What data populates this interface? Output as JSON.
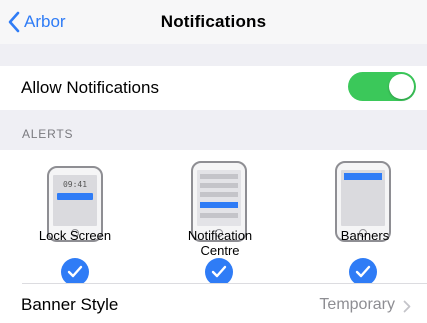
{
  "navbar": {
    "back_label": "Arbor",
    "title": "Notifications"
  },
  "allow": {
    "label": "Allow Notifications",
    "enabled": true
  },
  "alerts": {
    "header": "ALERTS",
    "options": [
      {
        "label": "Lock Screen",
        "checked": true,
        "time_text": "09:41"
      },
      {
        "label": "Notification\nCentre",
        "checked": true
      },
      {
        "label": "Banners",
        "checked": true
      }
    ]
  },
  "banner_style": {
    "label": "Banner Style",
    "value": "Temporary"
  },
  "colors": {
    "accent": "#2f7cf6",
    "toggle_on": "#3bc85a",
    "group_bg": "#efeff4"
  }
}
